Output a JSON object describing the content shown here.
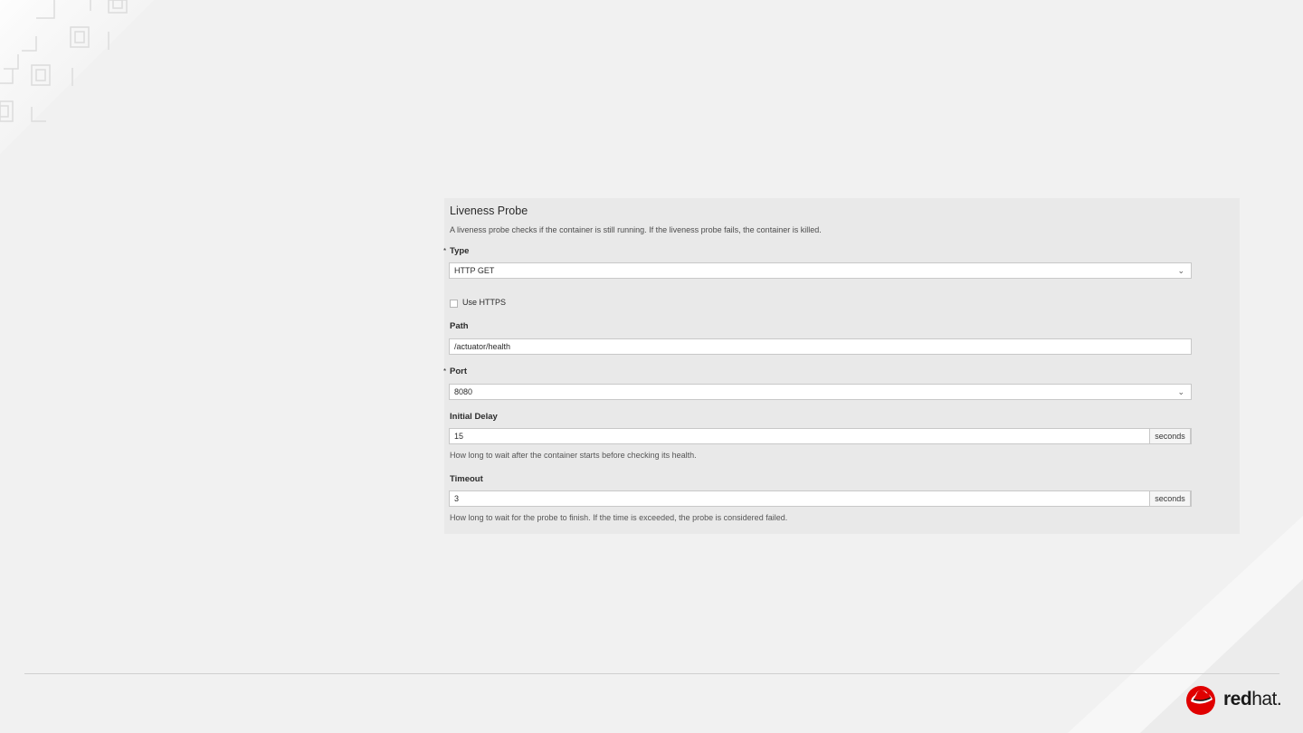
{
  "probe": {
    "title": "Liveness Probe",
    "description": "A liveness probe checks if the container is still running. If the liveness probe fails, the container is killed.",
    "type": {
      "label": "Type",
      "required_mark": "*",
      "value": "HTTP GET"
    },
    "use_https": {
      "label": "Use HTTPS",
      "checked": false
    },
    "path": {
      "label": "Path",
      "value": "/actuator/health"
    },
    "port": {
      "label": "Port",
      "required_mark": "*",
      "value": "8080"
    },
    "initial_delay": {
      "label": "Initial Delay",
      "value": "15",
      "unit": "seconds",
      "help": "How long to wait after the container starts before checking its health."
    },
    "timeout": {
      "label": "Timeout",
      "value": "3",
      "unit": "seconds",
      "help": "How long to wait for the probe to finish. If the time is exceeded, the probe is considered failed."
    }
  },
  "icons": {
    "select_chevron": "chevron-down-icon"
  },
  "brand": {
    "bold": "red",
    "light": "hat",
    "dot": ".",
    "color": "#e00000"
  }
}
